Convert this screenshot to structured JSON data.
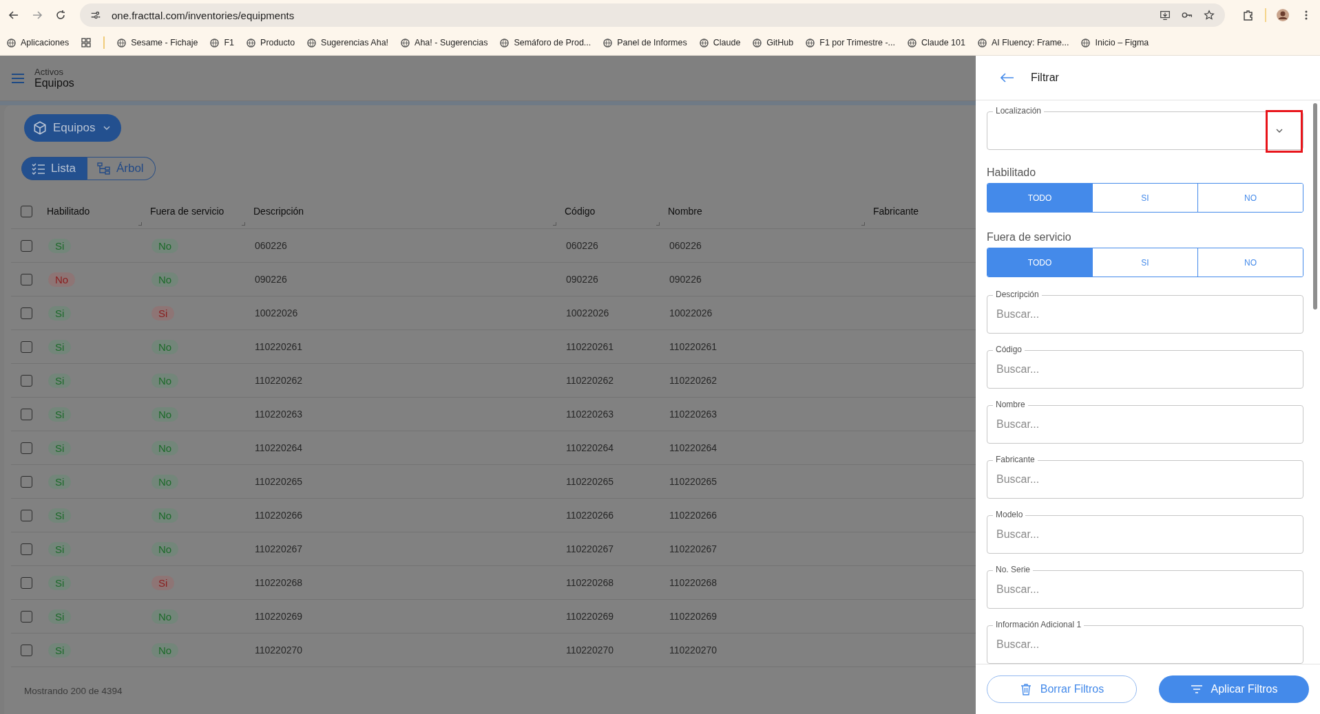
{
  "browser": {
    "url": "one.fracttal.com/inventories/equipments",
    "bookmarks": [
      {
        "label": "Aplicaciones"
      },
      {
        "label": "Sesame - Fichaje"
      },
      {
        "label": "F1"
      },
      {
        "label": "Producto"
      },
      {
        "label": "Sugerencias Aha!"
      },
      {
        "label": "Aha! - Sugerencias"
      },
      {
        "label": "Semáforo de Prod..."
      },
      {
        "label": "Panel de Informes"
      },
      {
        "label": "Claude"
      },
      {
        "label": "GitHub"
      },
      {
        "label": "F1 por Trimestre -..."
      },
      {
        "label": "Claude 101"
      },
      {
        "label": "AI Fluency: Frame..."
      },
      {
        "label": "Inicio – Figma"
      }
    ]
  },
  "app": {
    "breadcrumb": "Activos",
    "title": "Equipos",
    "entity_button": "Equipos",
    "view_toggle": [
      {
        "label": "Lista",
        "selected": true
      },
      {
        "label": "Árbol",
        "selected": false
      }
    ],
    "table": {
      "all_checked": false,
      "columns": [
        "Habilitado",
        "Fuera de servicio",
        "Descripción",
        "Código",
        "Nombre",
        "Fabricante"
      ],
      "rows": [
        {
          "checked": false,
          "enabled": {
            "text": "Si",
            "kind": "positive"
          },
          "out_of_service": {
            "text": "No",
            "kind": "positive"
          },
          "description": "060226",
          "code": "060226",
          "name": "060226"
        },
        {
          "checked": false,
          "enabled": {
            "text": "No",
            "kind": "negative"
          },
          "out_of_service": {
            "text": "No",
            "kind": "positive"
          },
          "description": "090226",
          "code": "090226",
          "name": "090226"
        },
        {
          "checked": false,
          "enabled": {
            "text": "Si",
            "kind": "positive"
          },
          "out_of_service": {
            "text": "Si",
            "kind": "negative"
          },
          "description": "10022026",
          "code": "10022026",
          "name": "10022026"
        },
        {
          "checked": false,
          "enabled": {
            "text": "Si",
            "kind": "positive"
          },
          "out_of_service": {
            "text": "No",
            "kind": "positive"
          },
          "description": "110220261",
          "code": "110220261",
          "name": "110220261"
        },
        {
          "checked": false,
          "enabled": {
            "text": "Si",
            "kind": "positive"
          },
          "out_of_service": {
            "text": "No",
            "kind": "positive"
          },
          "description": "110220262",
          "code": "110220262",
          "name": "110220262"
        },
        {
          "checked": false,
          "enabled": {
            "text": "Si",
            "kind": "positive"
          },
          "out_of_service": {
            "text": "No",
            "kind": "positive"
          },
          "description": "110220263",
          "code": "110220263",
          "name": "110220263"
        },
        {
          "checked": false,
          "enabled": {
            "text": "Si",
            "kind": "positive"
          },
          "out_of_service": {
            "text": "No",
            "kind": "positive"
          },
          "description": "110220264",
          "code": "110220264",
          "name": "110220264"
        },
        {
          "checked": false,
          "enabled": {
            "text": "Si",
            "kind": "positive"
          },
          "out_of_service": {
            "text": "No",
            "kind": "positive"
          },
          "description": "110220265",
          "code": "110220265",
          "name": "110220265"
        },
        {
          "checked": false,
          "enabled": {
            "text": "Si",
            "kind": "positive"
          },
          "out_of_service": {
            "text": "No",
            "kind": "positive"
          },
          "description": "110220266",
          "code": "110220266",
          "name": "110220266"
        },
        {
          "checked": false,
          "enabled": {
            "text": "Si",
            "kind": "positive"
          },
          "out_of_service": {
            "text": "No",
            "kind": "positive"
          },
          "description": "110220267",
          "code": "110220267",
          "name": "110220267"
        },
        {
          "checked": false,
          "enabled": {
            "text": "Si",
            "kind": "positive"
          },
          "out_of_service": {
            "text": "Si",
            "kind": "negative"
          },
          "description": "110220268",
          "code": "110220268",
          "name": "110220268"
        },
        {
          "checked": false,
          "enabled": {
            "text": "Si",
            "kind": "positive"
          },
          "out_of_service": {
            "text": "No",
            "kind": "positive"
          },
          "description": "110220269",
          "code": "110220269",
          "name": "110220269"
        },
        {
          "checked": false,
          "enabled": {
            "text": "Si",
            "kind": "positive"
          },
          "out_of_service": {
            "text": "No",
            "kind": "positive"
          },
          "description": "110220270",
          "code": "110220270",
          "name": "110220270"
        }
      ]
    },
    "footer": "Mostrando 200 de 4394"
  },
  "filter_panel": {
    "title": "Filtrar",
    "location": {
      "label": "Localización"
    },
    "segments": [
      {
        "label": "Habilitado",
        "options": [
          {
            "label": "TODO",
            "selected": true
          },
          {
            "label": "SI",
            "selected": false
          },
          {
            "label": "NO",
            "selected": false
          }
        ]
      },
      {
        "label": "Fuera de servicio",
        "options": [
          {
            "label": "TODO",
            "selected": true
          },
          {
            "label": "SI",
            "selected": false
          },
          {
            "label": "NO",
            "selected": false
          }
        ]
      }
    ],
    "fields": [
      {
        "label": "Descripción",
        "placeholder": "Buscar..."
      },
      {
        "label": "Código",
        "placeholder": "Buscar..."
      },
      {
        "label": "Nombre",
        "placeholder": "Buscar..."
      },
      {
        "label": "Fabricante",
        "placeholder": "Buscar..."
      },
      {
        "label": "Modelo",
        "placeholder": "Buscar..."
      },
      {
        "label": "No. Serie",
        "placeholder": "Buscar..."
      },
      {
        "label": "Información Adicional 1",
        "placeholder": "Buscar..."
      }
    ],
    "clear_button": "Borrar Filtros",
    "apply_button": "Aplicar Filtros"
  }
}
